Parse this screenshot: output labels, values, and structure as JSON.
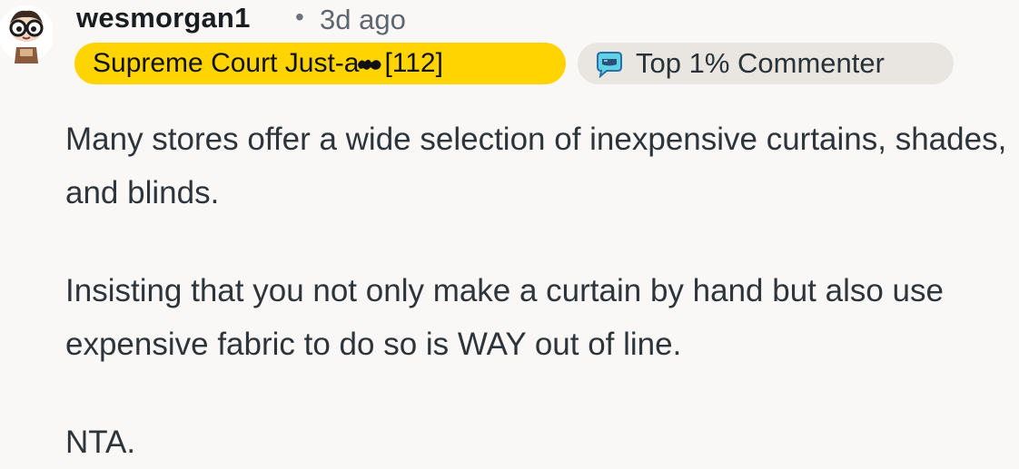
{
  "comment": {
    "author": "wesmorgan1",
    "separator": "•",
    "age": "3d ago",
    "flair_text": "Supreme Court Just-a",
    "flair_suffix": "[112]",
    "badge_label": "Top 1% Commenter",
    "paragraphs": [
      "Many stores offer a wide selection of inexpensive curtains, shades, and blinds.",
      "Insisting that you not only make a curtain by hand but also use expensive fabric to do so is WAY out of line.",
      "NTA."
    ]
  },
  "icons": {
    "avatar": "avatar-icon",
    "badge": "top-commenter-icon"
  },
  "colors": {
    "background": "#f9f8f6",
    "flair_bg": "#ffd400",
    "badge_bg": "#e9e6e1",
    "text": "#2d353b",
    "meta": "#5f676e"
  }
}
